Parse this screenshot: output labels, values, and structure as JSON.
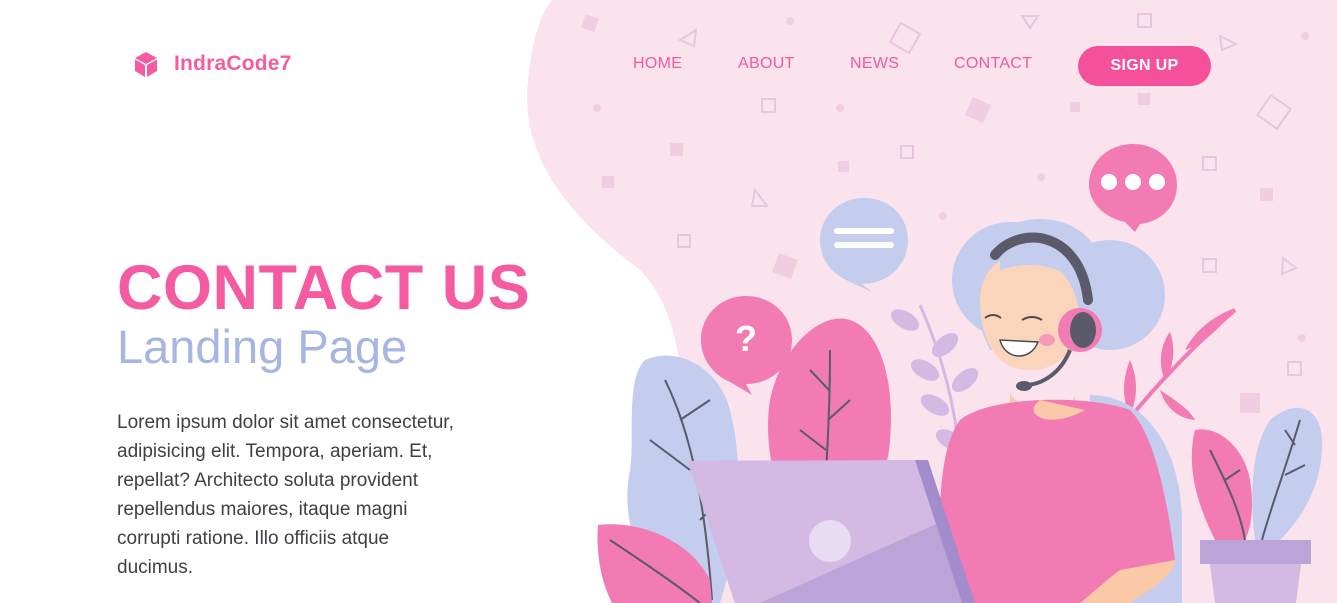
{
  "brand": {
    "name": "IndraCode7",
    "icon": "cube-icon"
  },
  "nav": {
    "items": [
      {
        "label": "HOME"
      },
      {
        "label": "ABOUT"
      },
      {
        "label": "NEWS"
      },
      {
        "label": "CONTACT"
      }
    ],
    "signup_label": "SIGN UP"
  },
  "hero": {
    "title": "CONTACT US",
    "subtitle": "Landing Page",
    "body": "Lorem ipsum dolor sit amet consectetur, adipisicing elit. Tempora, aperiam. Et, repellat? Architecto soluta provident repellendus maiores, itaque magni corrupti ratione. Illo officiis atque ducimus."
  },
  "illustration": {
    "icons": [
      "question-bubble-icon",
      "chat-lines-bubble-icon",
      "chat-dots-bubble-icon",
      "headset-icon",
      "laptop-icon"
    ]
  },
  "colors": {
    "accent": "#f45ba0",
    "accent_button": "#f4509b",
    "subtitle": "#a7b5e3",
    "blob": "#fbe3ee",
    "body_text": "#3f3f46"
  }
}
